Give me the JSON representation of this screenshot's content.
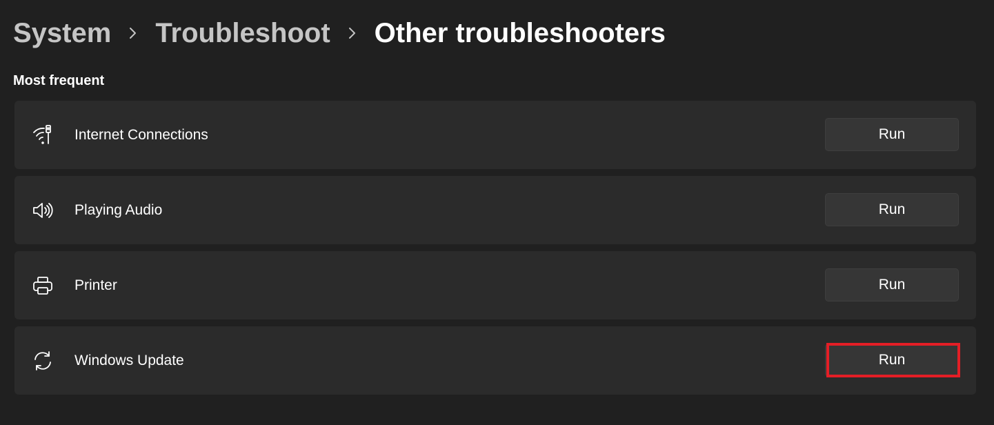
{
  "breadcrumb": {
    "items": [
      "System",
      "Troubleshoot"
    ],
    "current": "Other troubleshooters"
  },
  "section": {
    "title": "Most frequent"
  },
  "troubleshooters": [
    {
      "label": "Internet Connections",
      "icon": "wifi-icon",
      "button": "Run"
    },
    {
      "label": "Playing Audio",
      "icon": "speaker-icon",
      "button": "Run"
    },
    {
      "label": "Printer",
      "icon": "printer-icon",
      "button": "Run"
    },
    {
      "label": "Windows Update",
      "icon": "sync-icon",
      "button": "Run",
      "highlighted": true
    }
  ],
  "colors": {
    "background": "#202020",
    "card": "#2b2b2b",
    "button": "#363636",
    "highlight": "#e41e26"
  }
}
